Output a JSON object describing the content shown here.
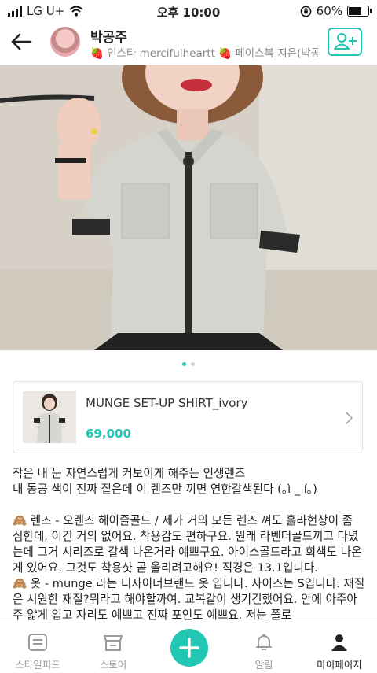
{
  "status_bar": {
    "carrier": "LG U+",
    "time": "오후 10:00",
    "battery": "60%"
  },
  "header": {
    "username": "박공주",
    "subtitle": "🍓 인스타 mercifulheartt 🍓 페이스북 지은(박공주"
  },
  "carousel": {
    "count": 2,
    "active_index": 0
  },
  "product": {
    "name": "MUNGE SET-UP SHIRT_ivory",
    "price": "69,000"
  },
  "post": {
    "lines": [
      "작은 내 눈 자연스럽게 커보이게 해주는 인생렌즈",
      "내 동공 색이 진짜 짙은데 이 렌즈만 끼면 연한갈색된다 (｡ì _ í｡)"
    ],
    "paragraphs": [
      "🙈 렌즈 - 오렌즈 헤이즐골드 / 제가 거의 모든 렌즈 껴도 홀라현상이 좀 심한데, 이건 거의 없어요. 착용감도 편하구요. 원래 라벤더골드끼고 다녔는데 그거 시리즈로 갈색 나온거라 예쁘구요. 아이스골드라고 회색도 나온 게 있어요. 그것도 착용샷 곧 올리려고해요! 직경은 13.1입니다.",
      "🙈 옷 - munge 라는 디자이너브랜드 옷 입니다. 사이즈는 S입니다. 재질은 시원한 재질?뭐라고 해야할까여. 교복같이 생기긴했어요. 안에 아주아주 얇게 입고 자리도 예쁘고 진짜 포인도 예쁘요. 저는 폴로"
    ]
  },
  "bottom_nav": {
    "items": [
      "스타일피드",
      "스토어",
      "알림",
      "마이페이지"
    ],
    "active": "마이페이지"
  },
  "colors": {
    "accent": "#21c7b3",
    "text": "#222222",
    "muted": "#9a9a9a"
  }
}
